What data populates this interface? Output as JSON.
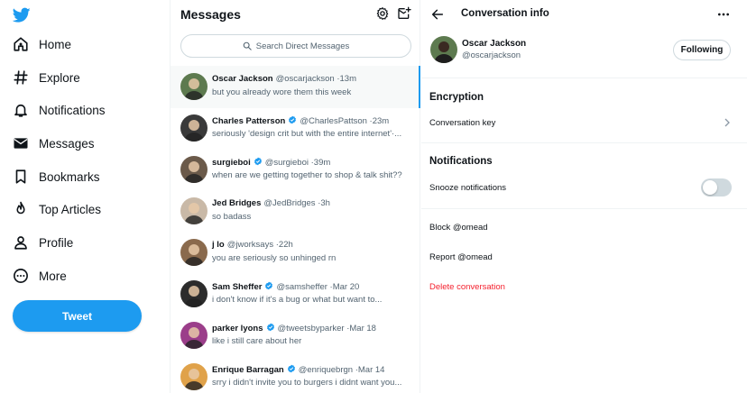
{
  "nav": {
    "logo_icon": "twitter-bird-icon",
    "items": [
      {
        "label": "Home",
        "icon": "home-icon"
      },
      {
        "label": "Explore",
        "icon": "hashtag-icon"
      },
      {
        "label": "Notifications",
        "icon": "bell-icon"
      },
      {
        "label": "Messages",
        "icon": "envelope-icon"
      },
      {
        "label": "Bookmarks",
        "icon": "bookmark-icon"
      },
      {
        "label": "Top Articles",
        "icon": "flame-icon"
      },
      {
        "label": "Profile",
        "icon": "person-icon"
      },
      {
        "label": "More",
        "icon": "more-circle-icon"
      }
    ],
    "tweet_label": "Tweet"
  },
  "messages": {
    "title": "Messages",
    "settings_icon": "gear-icon",
    "compose_icon": "new-message-icon",
    "search_placeholder": "Search Direct Messages",
    "conversations": [
      {
        "name": "Oscar Jackson",
        "handle": "@oscarjackson",
        "time": "13m",
        "preview": "but you already wore them this week",
        "verified": false,
        "selected": true,
        "avatar_color": "#5d7a4f"
      },
      {
        "name": "Charles Patterson",
        "handle": "@CharlesPattson",
        "time": "23m",
        "preview": "seriously 'design crit but with the entire internet'·...",
        "verified": true,
        "selected": false,
        "avatar_color": "#3a3a3a"
      },
      {
        "name": "surgieboi",
        "handle": "@surgieboi",
        "time": "39m",
        "preview": "when are we getting together to shop & talk shit??",
        "verified": true,
        "selected": false,
        "avatar_color": "#6b5a4a"
      },
      {
        "name": "Jed Bridges",
        "handle": "@JedBridges",
        "time": "3h",
        "preview": "so badass",
        "verified": false,
        "selected": false,
        "avatar_color": "#c9b9a7"
      },
      {
        "name": "j lo",
        "handle": "@jworksays",
        "time": "22h",
        "preview": "you are seriously so unhinged rn",
        "verified": false,
        "selected": false,
        "avatar_color": "#8a6a4d"
      },
      {
        "name": "Sam Sheffer",
        "handle": "@samsheffer",
        "time": "Mar 20",
        "preview": "i don't know if it's a bug or what but want to...",
        "verified": true,
        "selected": false,
        "avatar_color": "#2c2c2c"
      },
      {
        "name": "parker lyons",
        "handle": "@tweetsbyparker",
        "time": "Mar 18",
        "preview": "like i still care about her",
        "verified": true,
        "selected": false,
        "avatar_color": "#9b3e8a"
      },
      {
        "name": "Enrique Barragan",
        "handle": "@enriquebrgn",
        "time": "Mar 14",
        "preview": "srry i didn't invite you to burgers i didnt want you...",
        "verified": true,
        "selected": false,
        "avatar_color": "#e0a24a"
      }
    ]
  },
  "info": {
    "back_icon": "arrow-left-icon",
    "title": "Conversation info",
    "more_icon": "more-horizontal-icon",
    "profile": {
      "name": "Oscar Jackson",
      "handle": "@oscarjackson",
      "follow_label": "Following",
      "avatar_color": "#5d7a4f"
    },
    "encryption_heading": "Encryption",
    "conversation_key_label": "Conversation key",
    "notifications_heading": "Notifications",
    "snooze_label": "Snooze notifications",
    "snooze_on": false,
    "block_label": "Block @omead",
    "report_label": "Report @omead",
    "delete_label": "Delete conversation"
  },
  "colors": {
    "accent": "#1d9bf0",
    "danger": "#f4212e",
    "text": "#0f1419",
    "muted": "#536471"
  }
}
